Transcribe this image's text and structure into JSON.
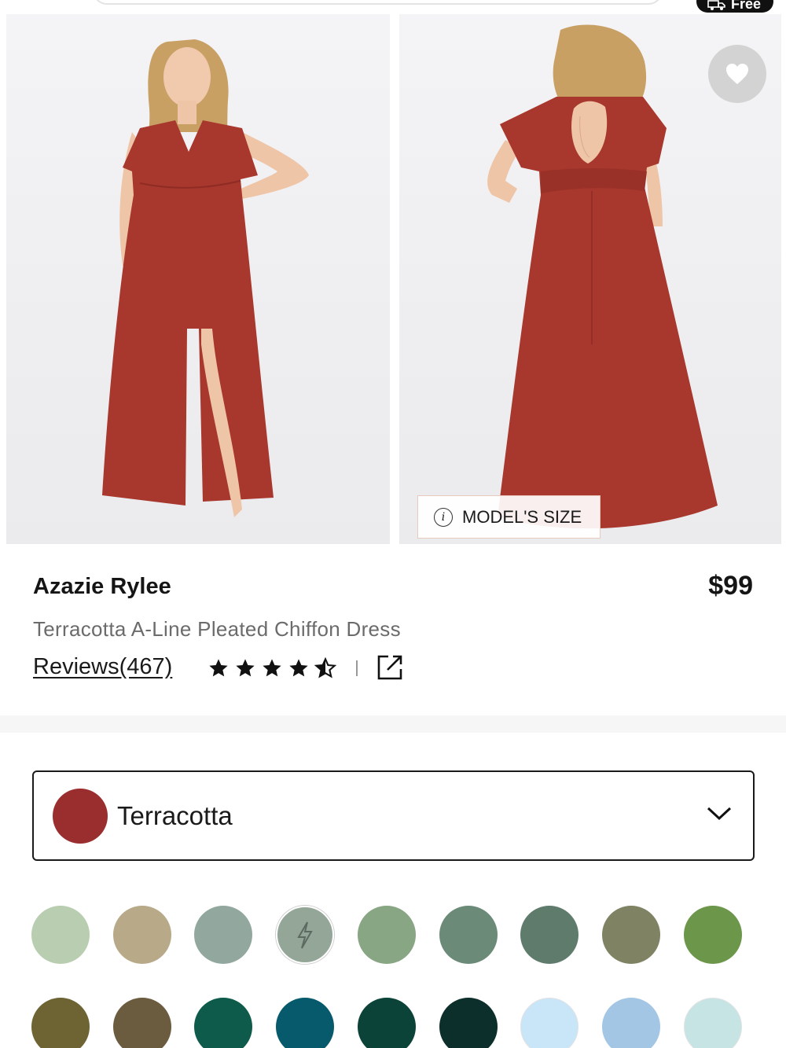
{
  "header": {
    "shipping_badge": "Free"
  },
  "gallery": {
    "favorite_icon": "heart-icon",
    "models_size_label": "MODEL'S SIZE",
    "info_icon": "info-icon",
    "dress_color": "#a8372d"
  },
  "product": {
    "brand": "Azazie Rylee",
    "price": "$99",
    "subtitle": "Terracotta A-Line Pleated Chiffon Dress",
    "reviews_label": "Reviews(467)",
    "rating": 4.5,
    "rating_max": 5,
    "share_icon": "external-link-icon"
  },
  "color_picker": {
    "selected_name": "Terracotta",
    "selected_color": "#9a2e2e",
    "dropdown_icon": "chevron-down-icon",
    "swatches_row1": [
      "#b9cdb0",
      "#b8aa89",
      "#92a89f",
      "#94a698",
      "#88a683",
      "#6b8b78",
      "#5f7b6c",
      "#7f8363",
      "#6c974b"
    ],
    "swatches_row2": [
      "#6e6433",
      "#6b5b3f",
      "#0e5b4b",
      "#075a6b",
      "#0b4339",
      "#0d2f2b",
      "#c9e5f8",
      "#a3c6e5",
      "#c7e4e5"
    ],
    "lightning_swatch_index": 3
  }
}
